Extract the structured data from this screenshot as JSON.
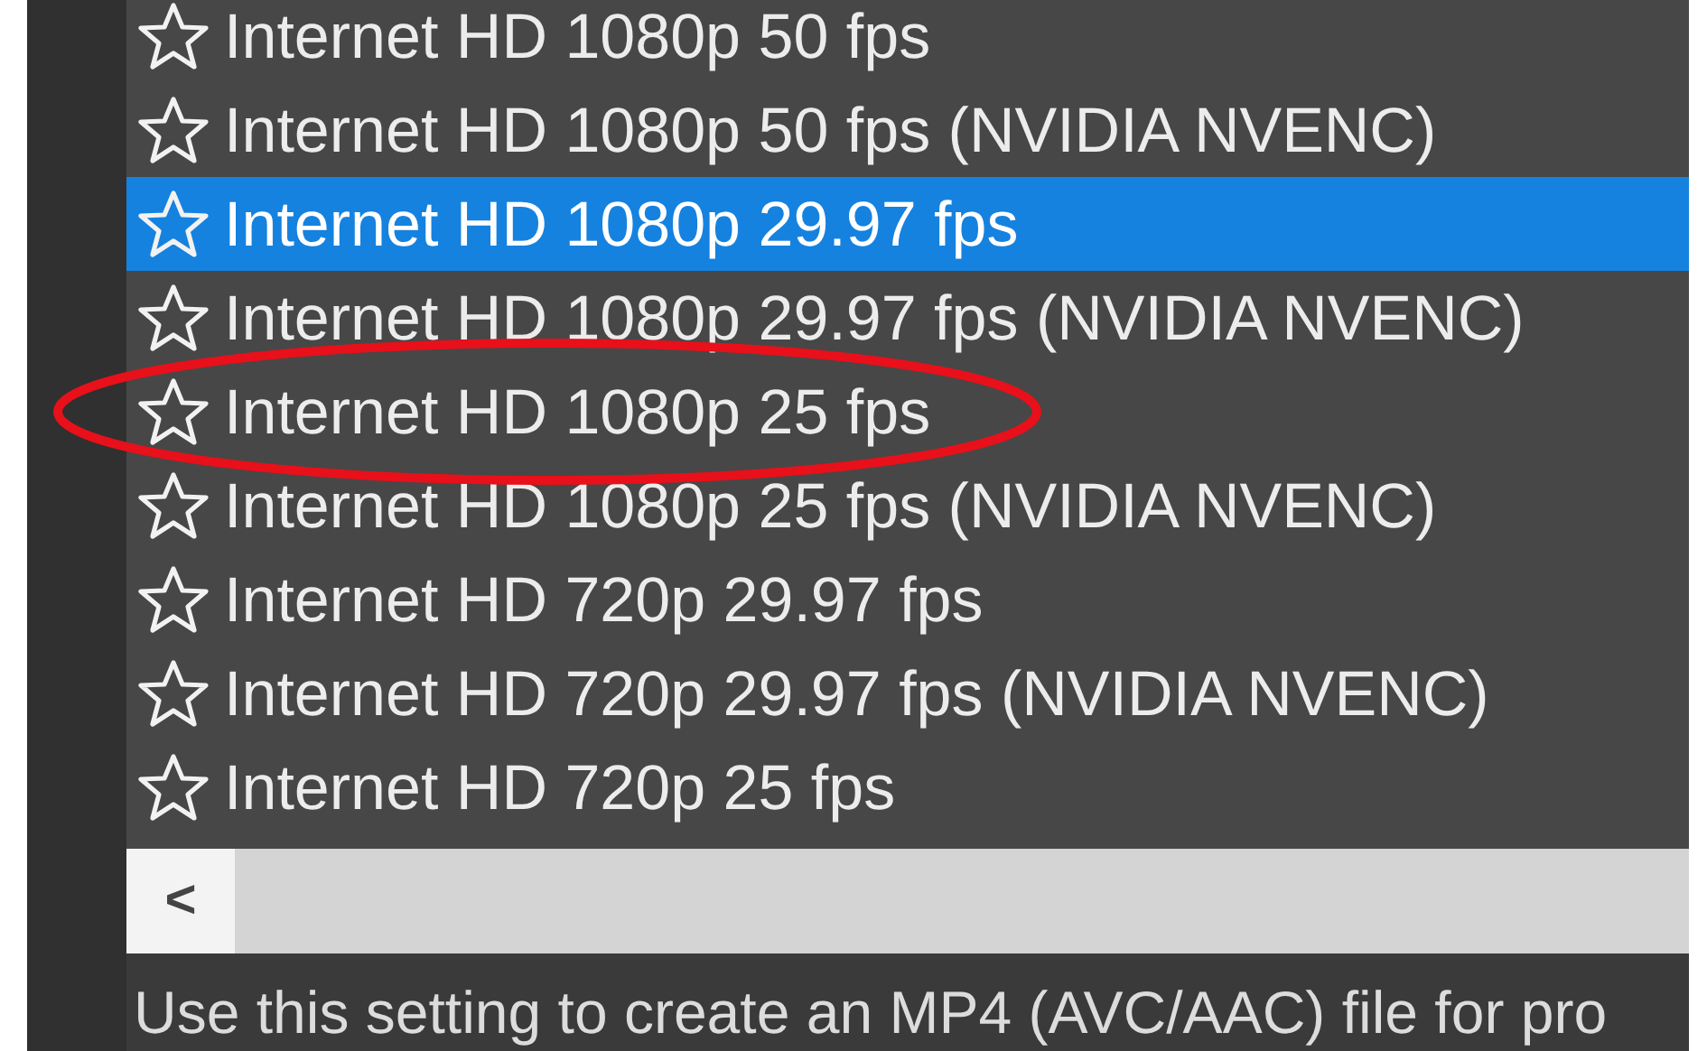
{
  "presets": [
    {
      "label": "Internet HD 1080p 50 fps",
      "selected": false,
      "circled": false
    },
    {
      "label": "Internet HD 1080p 50 fps (NVIDIA NVENC)",
      "selected": false,
      "circled": false
    },
    {
      "label": "Internet HD 1080p 29.97 fps",
      "selected": true,
      "circled": false
    },
    {
      "label": "Internet HD 1080p 29.97 fps (NVIDIA NVENC)",
      "selected": false,
      "circled": false
    },
    {
      "label": "Internet HD 1080p 25 fps",
      "selected": false,
      "circled": true
    },
    {
      "label": "Internet HD 1080p 25 fps (NVIDIA NVENC)",
      "selected": false,
      "circled": false
    },
    {
      "label": "Internet HD 720p 29.97 fps",
      "selected": false,
      "circled": false
    },
    {
      "label": "Internet HD 720p 29.97 fps (NVIDIA NVENC)",
      "selected": false,
      "circled": false
    },
    {
      "label": "Internet HD 720p 25 fps",
      "selected": false,
      "circled": false
    }
  ],
  "scrollbar": {
    "left_arrow": "<"
  },
  "description": "Use this setting to create an MP4 (AVC/AAC) file for pro"
}
